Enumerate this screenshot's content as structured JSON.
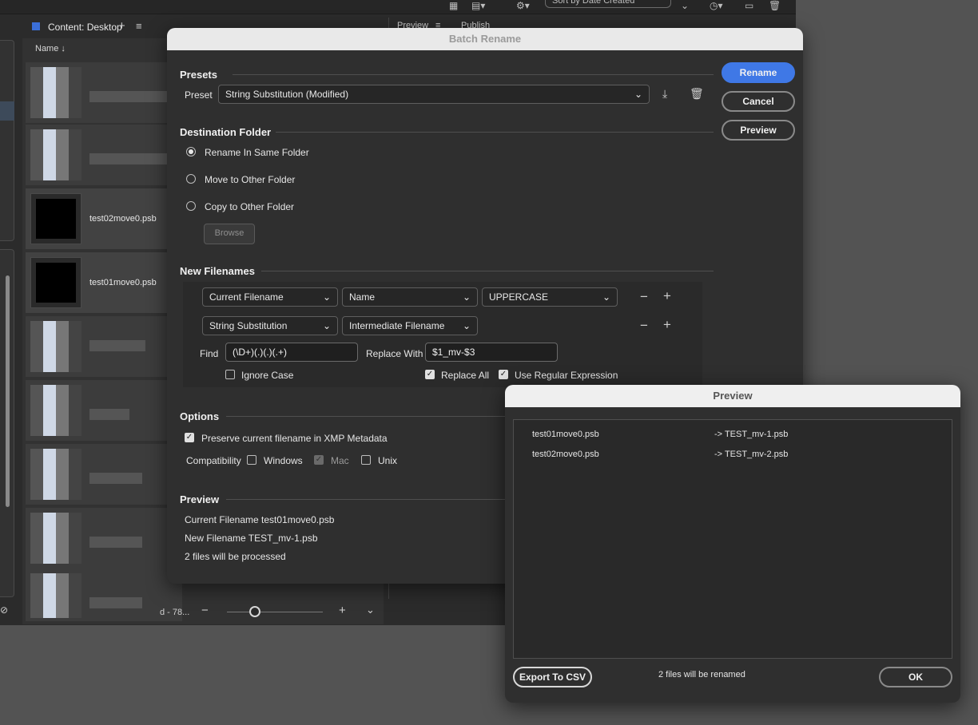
{
  "background_app": {
    "top_sort_label": "Sort by Date Created",
    "content_panel_title": "Content: Desktop",
    "column_name": "Name",
    "files": [
      "test02move0.psb",
      "test01move0.psb"
    ],
    "bottom_status": "d - 78...",
    "tabs": [
      "Preview",
      "Publish"
    ]
  },
  "batch_rename": {
    "title": "Batch Rename",
    "presets": {
      "heading": "Presets",
      "label": "Preset",
      "value": "String Substitution (Modified)"
    },
    "destination": {
      "heading": "Destination Folder",
      "options": [
        "Rename In Same Folder",
        "Move to Other Folder",
        "Copy to Other Folder"
      ],
      "selected": 0,
      "browse": "Browse"
    },
    "new_filenames": {
      "heading": "New Filenames",
      "row1": [
        "Current Filename",
        "Name",
        "UPPERCASE"
      ],
      "row2": [
        "String Substitution",
        "Intermediate Filename"
      ],
      "find_label": "Find",
      "find_value": "(\\D+)(.)(.)(.+)",
      "replace_label": "Replace With",
      "replace_value": "$1_mv-$3",
      "ignore_case": "Ignore Case",
      "replace_all": "Replace All",
      "use_regex": "Use Regular Expression"
    },
    "options": {
      "heading": "Options",
      "preserve": "Preserve current filename in XMP Metadata",
      "compat_label": "Compatibility",
      "windows": "Windows",
      "mac": "Mac",
      "unix": "Unix"
    },
    "preview": {
      "heading": "Preview",
      "current": "Current Filename test01move0.psb",
      "new": "New Filename TEST_mv-1.psb",
      "count": "2 files will be processed"
    },
    "buttons": {
      "rename": "Rename",
      "cancel": "Cancel",
      "preview": "Preview"
    }
  },
  "preview_dialog": {
    "title": "Preview",
    "rows": [
      {
        "from": "test01move0.psb",
        "to": "-> TEST_mv-1.psb"
      },
      {
        "from": "test02move0.psb",
        "to": "-> TEST_mv-2.psb"
      }
    ],
    "export": "Export To CSV",
    "status": "2 files will be renamed",
    "ok": "OK"
  },
  "colors": {
    "accent": "#3f78e6",
    "dialog_bg": "#2f2f2f",
    "app_bg": "#535353"
  }
}
